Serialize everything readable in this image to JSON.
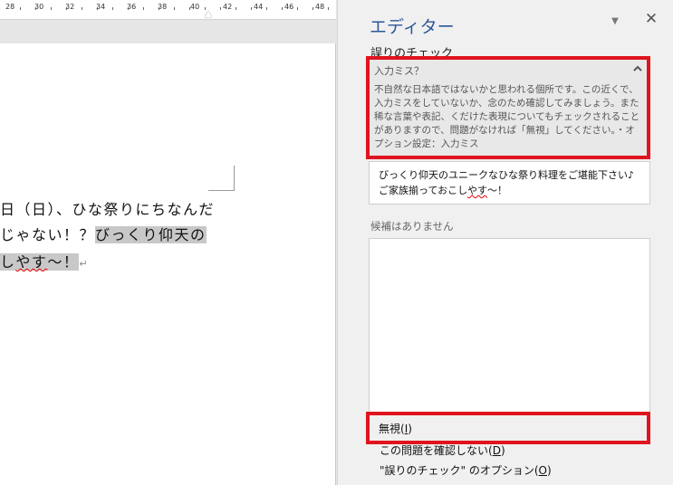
{
  "ruler": {
    "ticks": [
      "28",
      "30",
      "32",
      "34",
      "36",
      "38",
      "40",
      "42",
      "44",
      "46",
      "48"
    ]
  },
  "document": {
    "line1": "日（日）、ひな祭りにちなんだ",
    "line2_plain": "じゃない！？",
    "line2_highlight": "びっくり仰天の",
    "line3_highlight_pre": "し",
    "line3_squiggle": "やす",
    "line3_highlight_post": "〜！",
    "para_mark": "↵"
  },
  "pane": {
    "title": "エディター",
    "dropdown_icon": "chevron-down-icon",
    "close_label": "✕",
    "section_heading": "誤りのチェック",
    "issue": {
      "title": "入力ミス？",
      "description": "不自然な日本語ではないかと思われる個所です。この近くで、入力ミスをしていないか、念のため確認してみましょう。また稀な言葉や表記、くだけた表現についてもチェックされることがありますので、問題がなければ「無視」してください。・オプション設定：入力ミス"
    },
    "context": {
      "line1": "びっくり仰天のユニークなひな祭り料理をご堪能下さい♪",
      "line2_pre": "ご家族揃っておこし",
      "line2_squiggle": "やす",
      "line2_post": "〜！"
    },
    "suggestions_label": "候補はありません",
    "actions": {
      "ignore_label": "無視(",
      "ignore_key": "I",
      "ignore_close": ")",
      "dont_check_label": "この問題を確認しない(",
      "dont_check_key": "D",
      "dont_check_close": ")",
      "options_label": "\"誤りのチェック\" のオプション(",
      "options_key": "O",
      "options_close": ")"
    }
  },
  "colors": {
    "accent": "#2b579a",
    "highlight_box": "#e0141e",
    "text_highlight": "#c8c8c8"
  }
}
